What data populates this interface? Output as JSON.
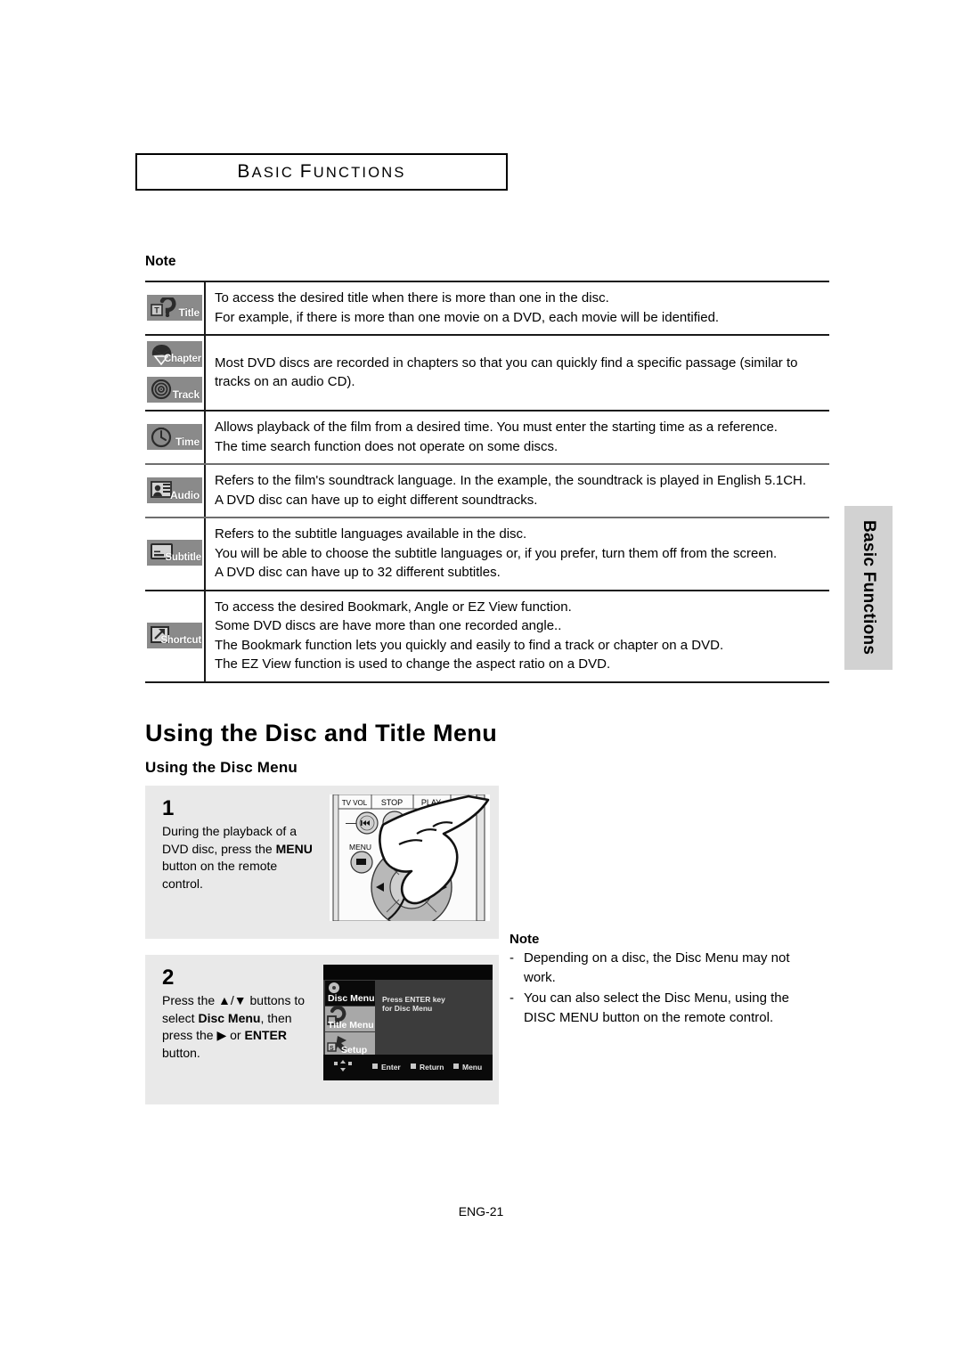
{
  "page": {
    "chapter_header": "Basic Functions",
    "side_tab": "Basic Functions",
    "footer": "ENG-21"
  },
  "note_table": {
    "label": "Note",
    "rows": [
      {
        "icons": [
          {
            "name": "title-icon",
            "label": "Title"
          }
        ],
        "lines": [
          "To access the desired title when there is more than one in the disc.",
          "For example, if there is more than one movie on a DVD, each movie will be identified."
        ]
      },
      {
        "icons": [
          {
            "name": "chapter-icon",
            "label": "Chapter"
          },
          {
            "name": "track-icon",
            "label": "Track"
          }
        ],
        "lines": [
          "Most DVD discs are recorded in chapters so that you can quickly find a specific passage (similar to",
          "tracks on an audio CD)."
        ]
      },
      {
        "icons": [
          {
            "name": "time-icon",
            "label": "Time"
          }
        ],
        "lines": [
          "Allows playback of the film from a desired time. You must enter the starting time as a reference.",
          "The time search function does not operate on some discs."
        ]
      },
      {
        "icons": [
          {
            "name": "audio-icon",
            "label": "Audio"
          }
        ],
        "lines": [
          "Refers to the film's soundtrack language. In the example, the soundtrack is played in English 5.1CH.",
          "A DVD disc can have up to eight different soundtracks."
        ]
      },
      {
        "icons": [
          {
            "name": "subtitle-icon",
            "label": "Subtitle"
          }
        ],
        "lines": [
          "Refers to the subtitle languages available in the disc.",
          "You will be able to choose the subtitle languages or, if you prefer, turn them off from the screen.",
          "A DVD disc can have up to 32 different subtitles."
        ]
      },
      {
        "icons": [
          {
            "name": "shortcut-icon",
            "label": "Shortcut"
          }
        ],
        "lines": [
          "To access the desired Bookmark, Angle or EZ View  function.",
          "Some DVD discs are have more than one recorded angle..",
          "The Bookmark function lets you quickly and easily to find a track or chapter on a DVD.",
          "The EZ View function is used to change the aspect ratio on a DVD."
        ]
      }
    ]
  },
  "section": {
    "heading": "Using the Disc and Title Menu",
    "subheading": "Using the Disc Menu",
    "steps": [
      {
        "number": "1",
        "lines": [
          {
            "text": "During the playback of a"
          },
          {
            "text": "DVD disc, press the ",
            "bold": "MENU"
          },
          {
            "text": "button on the remote"
          },
          {
            "text": "control."
          }
        ]
      },
      {
        "number": "2",
        "lines": [
          {
            "text": "Press the ▲/▼ buttons to"
          },
          {
            "text": "select ",
            "bold": "Disc Menu",
            "tail": ", then"
          },
          {
            "text": "press the ▶ or ",
            "bold": "ENTER"
          },
          {
            "text": "button."
          }
        ]
      }
    ]
  },
  "remote_figure": {
    "labels": {
      "tv_vol": "TV VOL",
      "stop": "STOP",
      "play": "PLAY",
      "menu": "MENU"
    }
  },
  "osd_figure": {
    "menu_items": [
      "Disc Menu",
      "Title Menu",
      "Setup"
    ],
    "body_lines": [
      "Press ENTER key",
      "for Disc Menu"
    ],
    "status_bar": [
      "Enter",
      "Return",
      "Menu"
    ],
    "colors": {
      "background": "#0a0a0a",
      "panel": "#3a3a3a",
      "selected": "#0a0a0a",
      "item": "#a8a8a8"
    }
  },
  "right_note": {
    "title": "Note",
    "bullets": [
      {
        "marker": "-",
        "lines": [
          "Depending on a disc, the Disc Menu may not",
          "work."
        ]
      },
      {
        "marker": "-",
        "lines": [
          "You can also select the Disc Menu, using the",
          "DISC MENU button on the remote control."
        ]
      }
    ]
  },
  "colors": {
    "badge_gray": "#8a8a8a",
    "panel_gray": "#e9e9e9",
    "tab_gray": "#d2d2d2",
    "rule_black": "#1a1a1a",
    "rule_gray": "#6e6e6e"
  }
}
